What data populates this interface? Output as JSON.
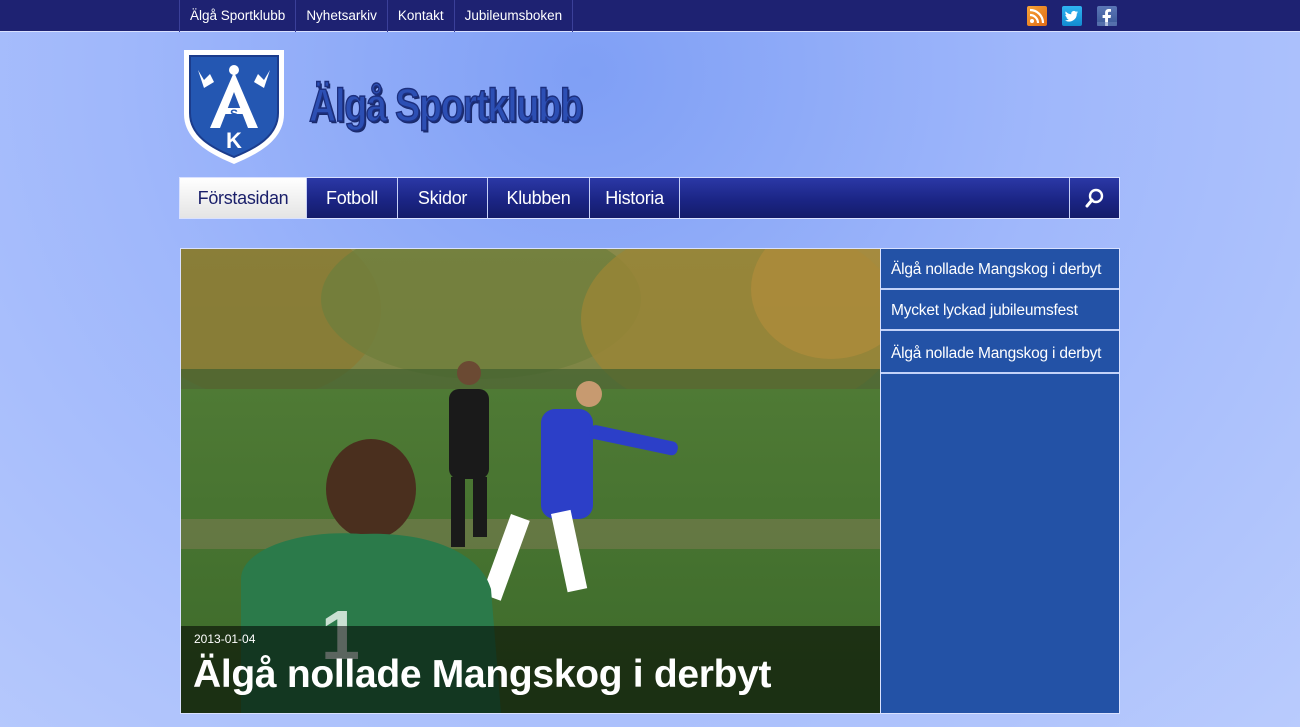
{
  "topnav": {
    "items": [
      "Älgå Sportklubb",
      "Nyhetsarkiv",
      "Kontakt",
      "Jubileumsboken"
    ]
  },
  "social": {
    "icons": [
      "rss-icon",
      "twitter-icon",
      "facebook-icon"
    ]
  },
  "header": {
    "logo_text": "ÅSK",
    "site_title": "Älgå Sportklubb"
  },
  "mainnav": {
    "items": [
      "Förstasidan",
      "Fotboll",
      "Skidor",
      "Klubben",
      "Historia"
    ],
    "active": "Förstasidan",
    "search_icon": "search-icon"
  },
  "slider": {
    "date": "2013-01-04",
    "title": "Älgå nollade Mangskog i derbyt",
    "side_items": [
      "Älgå nollade Mangskog i derbyt",
      "Mycket lyckad jubileumsfest",
      "Älgå nollade Mangskog i derbyt"
    ]
  },
  "colors": {
    "topbar": "#1e2272",
    "nav": "#1b2585",
    "accent_blue": "#2352a6",
    "title_blue": "#2c4fb4"
  }
}
